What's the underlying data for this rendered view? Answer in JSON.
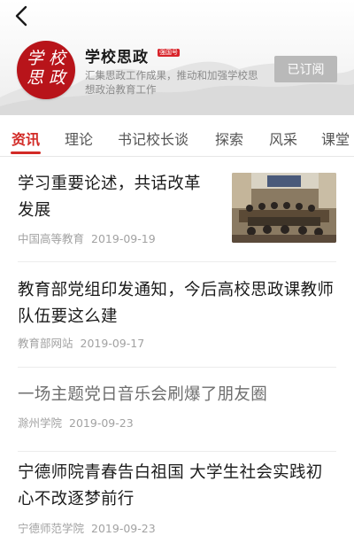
{
  "header": {
    "back_icon": "chevron-left-icon",
    "logo_chars": [
      "学",
      "校",
      "思",
      "政"
    ],
    "title": "学校思政",
    "badge": "强国号",
    "description": "汇集思政工作成果，推动和加强学校思想政治教育工作",
    "subscribe_label": "已订阅"
  },
  "tabs": [
    {
      "label": "资讯",
      "active": true
    },
    {
      "label": "理论",
      "active": false
    },
    {
      "label": "书记校长谈",
      "active": false
    },
    {
      "label": "探索",
      "active": false
    },
    {
      "label": "风采",
      "active": false
    },
    {
      "label": "课堂",
      "active": false
    }
  ],
  "articles": [
    {
      "title": "学习重要论述，共话改革发展",
      "source": "中国高等教育",
      "date": "2019-09-19",
      "has_thumbnail": true,
      "read": false
    },
    {
      "title": "教育部党组印发通知，今后高校思政课教师队伍要这么建",
      "source": "教育部网站",
      "date": "2019-09-17",
      "has_thumbnail": false,
      "read": false
    },
    {
      "title": "一场主题党日音乐会刷爆了朋友圈",
      "source": "滁州学院",
      "date": "2019-09-23",
      "has_thumbnail": false,
      "read": true
    },
    {
      "title": "宁德师院青春告白祖国  大学生社会实践初心不改逐梦前行",
      "source": "宁德师范学院",
      "date": "2019-09-23",
      "has_thumbnail": false,
      "read": false
    }
  ],
  "colors": {
    "accent": "#d22a26",
    "logo_bg": "#b8141a",
    "subscribed_button": "#b9b9b9"
  }
}
